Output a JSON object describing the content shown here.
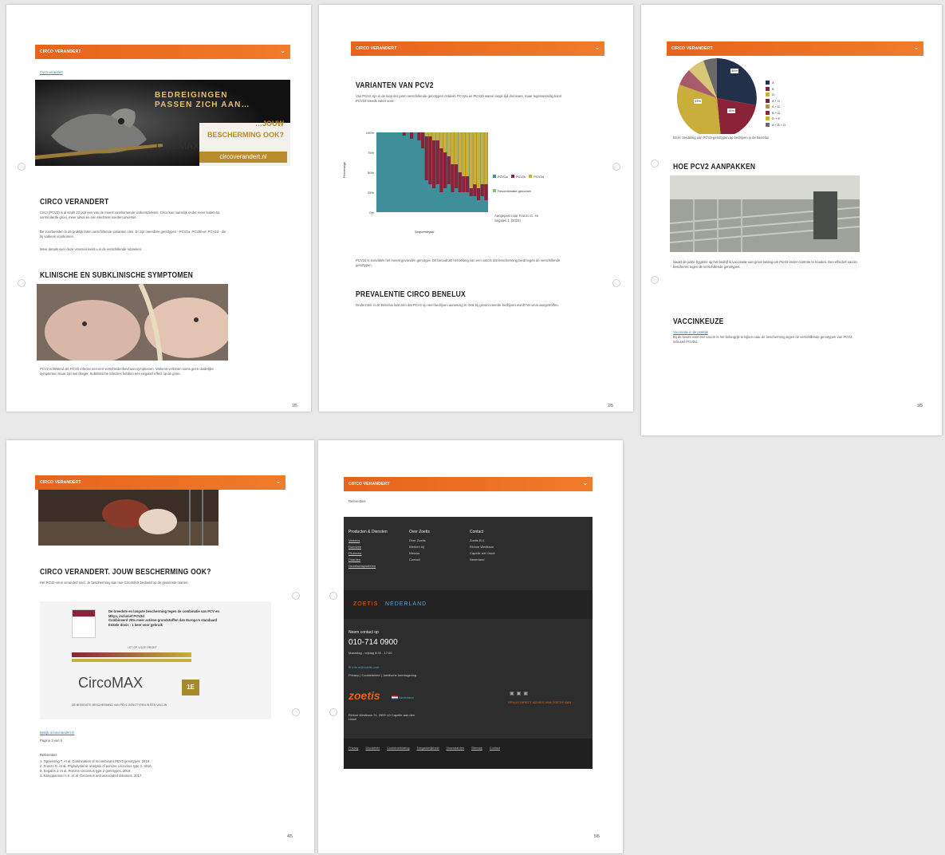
{
  "colors": {
    "orange": "#ee6f22",
    "teal": "#3e8f9a",
    "maroon": "#8a2338",
    "gold": "#c9ae3c",
    "navy": "#22304a"
  },
  "p1": {
    "bar": "CIRCO VERANDERT",
    "crumb": "Circo verandert",
    "banner_l1": "BEDREIGINGEN",
    "banner_l2": "PASSEN ZICH AAN…",
    "banner_r1": "…JOUW",
    "banner_r2": "BESCHERMING OOK?",
    "banner_brand": "CircoMAX",
    "banner_url": "circoverandert.nl",
    "h1": "CIRCO VERANDERT",
    "t1": "Circo (PCV2) is al sinds 20 jaar een van de meest voorkomende varkensziekten. Circo kan namelijk onder meer leiden tot verminderde groei, meer uitval en een slechtere voederconversie.",
    "t2": "De voorbeelden in de praktijk laten verschillende varianten zien. Er zijn meerdere genotypen - PCV2a, PCV2b en PCV2d - die bij varkens voorkomen.",
    "t3": "Meer details over deze virussen leest u in de verschillende rubrieken.",
    "h2": "KLINISCHE EN SUBKLINISCHE SYMPTOMEN",
    "t4": "PCV2 is bekend als PCVD infectie met een verscheidenheid aan symptomen. Varkens vertonen soms geen duidelijke symptomen maar zijn wel drager. Subklinische infecties hebben een negatief effect op de groei.",
    "page": "1/5"
  },
  "p2": {
    "bar": "CIRCO VERANDERT",
    "h1": "VARIANTEN VAN PCV2",
    "t1": "Van PCV2 zijn in de loop der jaren verschillende genotypen ontdekt. PCV2a en PCV2b waren lange tijd dominant, maar tegenwoordig komt PCV2d steeds vaker voor.",
    "y_label": "Percentage",
    "x_label": "Sequentiejaar",
    "chart_note": "Aangepast naar Franzo G. en Segalés J. (2018)",
    "t2": "PCV2d is inmiddels het meest gevonden genotype. Dit benadrukt het belang van een vaccin dat bescherming biedt tegen de verschillende genotypen.",
    "h2": "PREVALENTIE CIRCO BENELUX",
    "t3": "Onderzoek in de Benelux laat zien dat PCV2 op veel bedrijven aanwezig is. Ook bij gevaccineerde bedrijven wordt het virus aangetroffen.",
    "page": "2/5"
  },
  "chart_data": {
    "type": "bar",
    "stacked": true,
    "y_ticks": [
      "100%",
      "75%",
      "50%",
      "25%",
      "0%"
    ],
    "ylim": [
      0,
      100
    ],
    "series": [
      {
        "name": "PCV2a",
        "color": "#3e8f9a"
      },
      {
        "name": "PCV2b",
        "color": "#8a2338"
      },
      {
        "name": "PCV2d",
        "color": "#c9ae3c"
      },
      {
        "name": "Recombinatie genomen",
        "color": "#7fbf7f"
      }
    ],
    "bars": [
      [
        100,
        0,
        0
      ],
      [
        100,
        0,
        0
      ],
      [
        100,
        0,
        0
      ],
      [
        100,
        0,
        0
      ],
      [
        100,
        0,
        0
      ],
      [
        100,
        0,
        0
      ],
      [
        100,
        0,
        0
      ],
      [
        96,
        4,
        0
      ],
      [
        100,
        0,
        0
      ],
      [
        92,
        8,
        0
      ],
      [
        100,
        0,
        0
      ],
      [
        90,
        10,
        0
      ],
      [
        80,
        20,
        0
      ],
      [
        40,
        55,
        5
      ],
      [
        35,
        60,
        5
      ],
      [
        30,
        60,
        10
      ],
      [
        35,
        55,
        10
      ],
      [
        25,
        55,
        20
      ],
      [
        30,
        45,
        25
      ],
      [
        35,
        35,
        30
      ],
      [
        25,
        35,
        40
      ],
      [
        30,
        30,
        40
      ],
      [
        25,
        25,
        50
      ],
      [
        25,
        20,
        55
      ],
      [
        25,
        20,
        55
      ],
      [
        20,
        10,
        70
      ],
      [
        20,
        15,
        65
      ],
      [
        15,
        15,
        70
      ],
      [
        20,
        15,
        65
      ],
      [
        15,
        20,
        65
      ]
    ]
  },
  "p3": {
    "bar": "CIRCO VERANDERT",
    "legend": [
      "A",
      "B",
      "D",
      "A + D",
      "A + D",
      "B + D",
      "D + E",
      "A + B + D"
    ],
    "pie_labels": [
      "35%",
      "18%",
      "33%"
    ],
    "pie_note": "Bron: Verdeling van PCV2-genotypen op bedrijven in de Benelux",
    "h1": "HOE PCV2 AANPAKKEN",
    "t1": "Naast de juiste hygiëne op het bedrijf is vaccinatie van groot belang om PCV2 onder controle te houden. Een effectief vaccin beschermt tegen de verschillende genotypen.",
    "h2": "VACCINKEUZE",
    "link1": "Vaccinatie in de praktijk",
    "t2": "Bij de keuze voor een vaccin is het belangrijk te kijken naar de bescherming tegen de verschillende genotypen van PCV2, inclusief PCV2d.",
    "page": "3/5"
  },
  "p4": {
    "bar": "CIRCO VERANDERT",
    "h1": "CIRCO VERANDERT. JOUW BESCHERMING OOK?",
    "t1": "Het PCV2-virus verandert snel. Je bescherming kan met CircoMAX bedoeld op de gewenste manier.",
    "ad_b1": "De breedste en langste bescherming tegen de combinatie van PCV en Mhyo, inclusief PCV2d",
    "ad_b2": "Combineerd 20% meer actieve grondstoffen dan Europa's standaard",
    "ad_b3": "Enkele dosis - 1 keer voor gebruik",
    "ad_tag": "LET OP VOOR PROEF",
    "ad_brand": "CircoMAX",
    "ad_footer": "DE BREEDSTE BESCHERMING VAN PCV2 GENOTYPEN IN ÉÉN VACCIN",
    "ad_award": "1E",
    "link1": "Bekijk circoverandert.nl",
    "t2": "Pagina 3 van 5",
    "refs_title": "Referenties",
    "refs": [
      "1. Opriessnig T. et al. Combination of recombinant PCV2 genotypes. 2018.",
      "2. Franzo G. et al. Phylodynamic analysis of porcine circovirus type 2. 2016.",
      "3. Segalés J. et al. Porcine circovirus type 2 genotypes. 2019.",
      "4. Karuppannan A.K. et al. Circovirus and associated diseases. 2017."
    ],
    "page": "4/5"
  },
  "p5": {
    "bar": "CIRCO VERANDERT",
    "top_line": "Referenties",
    "col1_title": "Producten & Diensten",
    "col1": [
      "Varkens",
      "Rundvee",
      "Pluimvee",
      "Paarden",
      "Gezelschapsdieren"
    ],
    "col2_title": "Over Zoetis",
    "col2": [
      "Over Zoetis",
      "Werken bij",
      "Nieuws",
      "Contact"
    ],
    "col3_title": "Contact",
    "col3": [
      "Zoetis B.V.",
      "Rivium Westlaan",
      "Capelle a/d IJssel",
      "Nederland"
    ],
    "brand_a": "ZOETIS",
    "brand_b": "NEDERLAND",
    "contact_title": "Neem contact op",
    "phone": "010-714 0900",
    "hours": "Maandag - vrijdag 8:30 - 17:00",
    "email_link": "info.nl@zoetis.com",
    "legal_links": "Privacy | Cookiebeleid | Juridische kennisgeving",
    "logo": "zoetis",
    "country": "Nederland",
    "cta": "VRAAG DIRECT ADVIES VAN ZOETIS AAN",
    "addr": "Rivium Westlaan 74, 2909 LD Capelle aan den IJssel",
    "bottom": [
      "Privacy",
      "Disclaimer",
      "Cookieverklaring",
      "Toegankelijkheid",
      "Voorwaarden",
      "Sitemap",
      "Contact"
    ],
    "page": "5/5"
  }
}
